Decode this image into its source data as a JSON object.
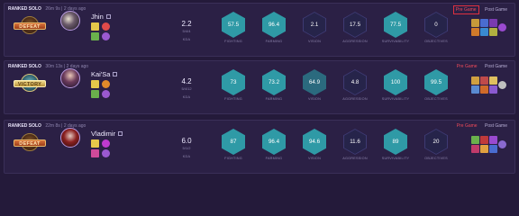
{
  "matches": [
    {
      "queue": "RANKED SOLO",
      "duration": "26m 9s",
      "sep": "|",
      "ago": "2 days ago",
      "tabs": {
        "pre": "Pre Game",
        "post": "Post Game"
      },
      "pre_outlined": true,
      "outcome": "DEFEAT",
      "champion": "Jhin",
      "champion_level": "",
      "kda_ratio": "2.2",
      "kda_score": "5/4/4",
      "kda_label": "KDA",
      "metrics": [
        {
          "label": "FIGHTING",
          "value": "57.5",
          "tier": "high"
        },
        {
          "label": "FARMING",
          "value": "96.4",
          "tier": "high"
        },
        {
          "label": "VISION",
          "value": "2.1",
          "tier": "low"
        },
        {
          "label": "AGGRESSION",
          "value": "17.5",
          "tier": "low"
        },
        {
          "label": "SURVIVABILITY",
          "value": "77.5",
          "tier": "high"
        },
        {
          "label": "OBJECTIVES",
          "value": "0",
          "tier": "low"
        }
      ],
      "spell_colors": [
        "#e6c84a",
        "#e04a4a",
        "#6ab04c",
        "#9b59d0"
      ],
      "item_colors": [
        "#c79a3a",
        "#4a6cd0",
        "#7a3ab0",
        "#d07a2a",
        "#3a8ad0",
        "#b0b040",
        "#9a4ad0"
      ]
    },
    {
      "queue": "RANKED SOLO",
      "duration": "30m 13s",
      "sep": "|",
      "ago": "2 days ago",
      "tabs": {
        "pre": "Pre Game",
        "post": "Post Game"
      },
      "pre_outlined": false,
      "outcome": "VICTORY",
      "champion": "Kai'Sa",
      "champion_level": "",
      "kda_ratio": "4.2",
      "kda_score": "5/4/12",
      "kda_label": "KDA",
      "metrics": [
        {
          "label": "FIGHTING",
          "value": "73",
          "tier": "high"
        },
        {
          "label": "FARMING",
          "value": "73.2",
          "tier": "high"
        },
        {
          "label": "VISION",
          "value": "64.9",
          "tier": "mid"
        },
        {
          "label": "AGGRESSION",
          "value": "4.8",
          "tier": "low"
        },
        {
          "label": "SURVIVABILITY",
          "value": "100",
          "tier": "high"
        },
        {
          "label": "OBJECTIVES",
          "value": "99.5",
          "tier": "high"
        }
      ],
      "spell_colors": [
        "#e6c84a",
        "#e08a2a",
        "#6ab04c",
        "#9b59d0"
      ],
      "item_colors": [
        "#d0a040",
        "#c04a4a",
        "#e0c060",
        "#5a8ad0",
        "#d06a2a",
        "#8a5ad0",
        "#c0c0c0"
      ]
    },
    {
      "queue": "RANKED SOLO",
      "duration": "22m 8s",
      "sep": "|",
      "ago": "2 days ago",
      "tabs": {
        "pre": "Pre Game",
        "post": "Post Game"
      },
      "pre_outlined": false,
      "outcome": "DEFEAT",
      "champion": "Vladimir",
      "champion_level": "",
      "kda_ratio": "6.0",
      "kda_score": "5/1/2",
      "kda_label": "KDA",
      "metrics": [
        {
          "label": "FIGHTING",
          "value": "87",
          "tier": "high"
        },
        {
          "label": "FARMING",
          "value": "96.4",
          "tier": "high"
        },
        {
          "label": "VISION",
          "value": "94.6",
          "tier": "high"
        },
        {
          "label": "AGGRESSION",
          "value": "11.6",
          "tier": "low"
        },
        {
          "label": "SURVIVABILITY",
          "value": "89",
          "tier": "high"
        },
        {
          "label": "OBJECTIVES",
          "value": "20",
          "tier": "low"
        }
      ],
      "spell_colors": [
        "#e6c84a",
        "#c03ad0",
        "#d04a9a",
        "#9b59d0"
      ],
      "item_colors": [
        "#6ab04c",
        "#c03a3a",
        "#9a4ad0",
        "#c03a6a",
        "#e0a040",
        "#4a6cd0",
        "#8a6ad0"
      ]
    }
  ]
}
